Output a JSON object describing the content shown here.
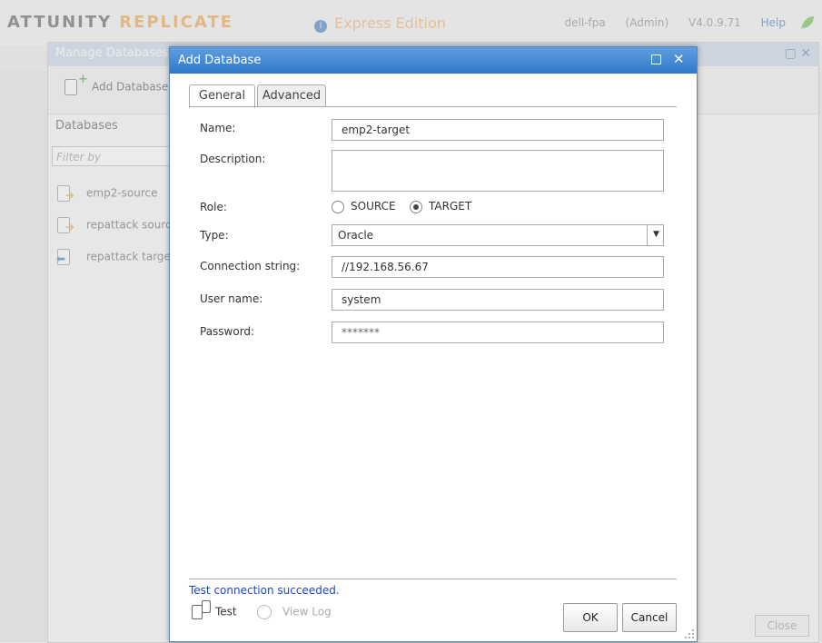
{
  "app": {
    "brand_main": "ATTUNITY",
    "brand_sub": "REPLICATE",
    "edition": "Express Edition",
    "host": "dell-fpa",
    "role": "(Admin)",
    "version": "V4.0.9.71",
    "help": "Help"
  },
  "manage": {
    "title": "Manage Databases",
    "add_label": "Add Database",
    "databases_header": "Databases",
    "filter_placeholder": "Filter by",
    "items": [
      {
        "label": "emp2-source",
        "kind": "source"
      },
      {
        "label": "repattack source",
        "kind": "source"
      },
      {
        "label": "repattack target",
        "kind": "target"
      }
    ],
    "close_label": "Close"
  },
  "dialog": {
    "title": "Add Database",
    "tabs": [
      {
        "label": "General",
        "active": true
      },
      {
        "label": "Advanced",
        "active": false
      }
    ],
    "fields": {
      "name_label": "Name:",
      "name_value": "emp2-target",
      "description_label": "Description:",
      "description_value": "",
      "role_label": "Role:",
      "role_source": "SOURCE",
      "role_target": "TARGET",
      "role_selected": "TARGET",
      "type_label": "Type:",
      "type_value": "Oracle",
      "conn_label": "Connection string:",
      "conn_value": "//192.168.56.67",
      "user_label": "User name:",
      "user_value": "system",
      "password_label": "Password:",
      "password_value": "*******"
    },
    "status": "Test connection succeeded.",
    "test_label": "Test",
    "viewlog_label": "View Log",
    "ok_label": "OK",
    "cancel_label": "Cancel"
  },
  "colors": {
    "title_bar": "#2f79c9",
    "status_text": "#1a46c8",
    "brand_accent": "#f0a040"
  }
}
